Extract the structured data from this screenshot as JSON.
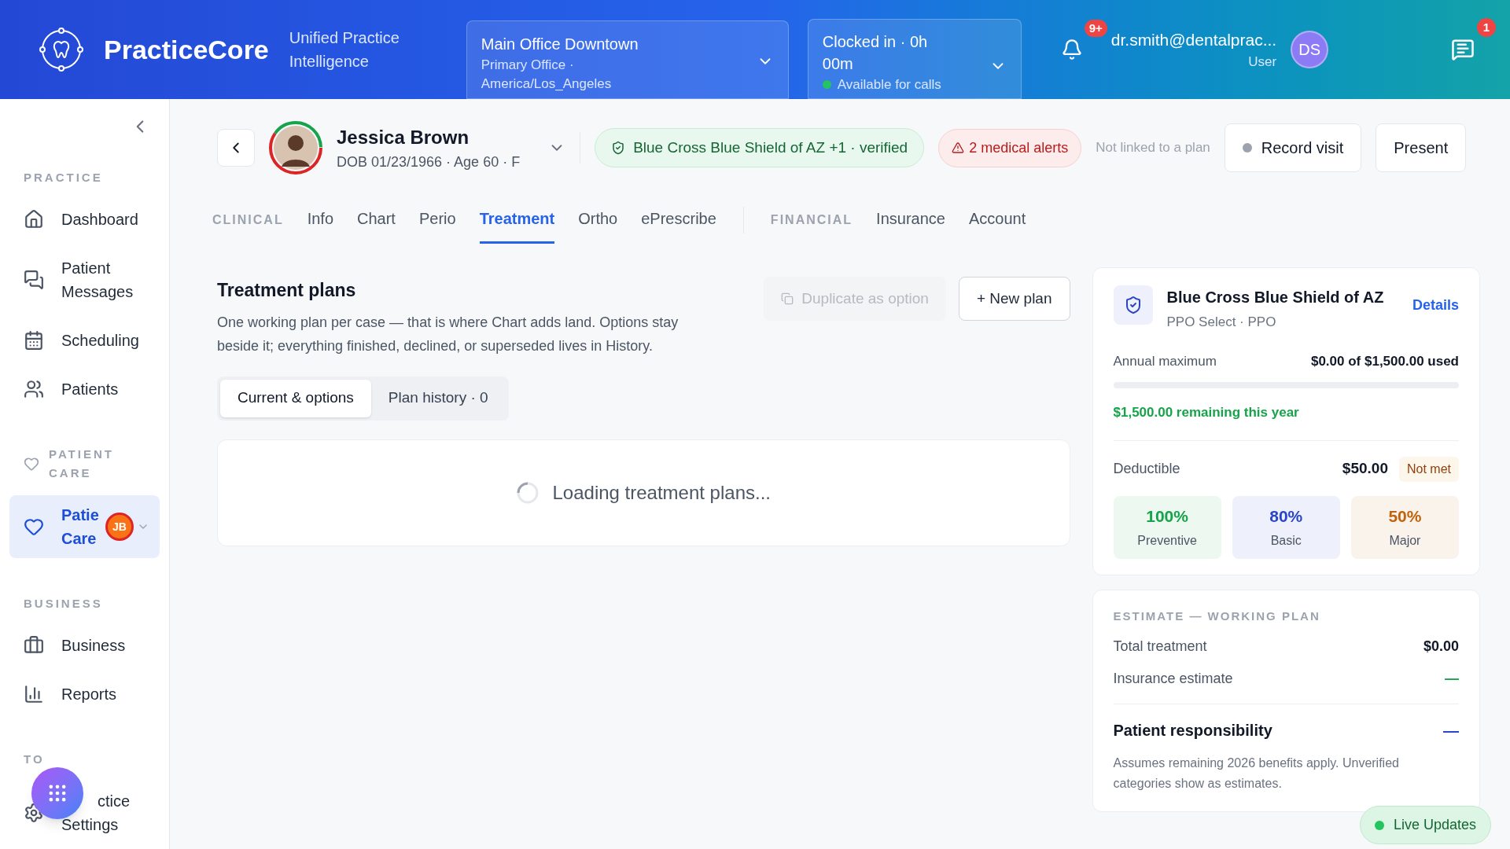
{
  "header": {
    "brand": "PracticeCore",
    "tagline": "Unified Practice Intelligence",
    "location": {
      "name": "Main Office Downtown",
      "detail": "Primary Office · America/Los_Angeles"
    },
    "clock": {
      "status": "Clocked in · 0h 00m",
      "availability": "Available for calls",
      "available": true
    },
    "notifications_badge": "9+",
    "user": {
      "email": "dr.smith@dentalprac...",
      "role": "User",
      "initials": "DS"
    },
    "messages_badge": "1"
  },
  "sidebar": {
    "sections": [
      {
        "title": "PRACTICE",
        "items": [
          {
            "label": "Dashboard",
            "selected": false
          },
          {
            "label": "Patient Messages",
            "selected": false
          },
          {
            "label": "Scheduling",
            "selected": false
          },
          {
            "label": "Patients",
            "selected": false
          }
        ]
      },
      {
        "title": "PATIENT CARE",
        "items": [
          {
            "label": "Patie Care",
            "selected": true,
            "badge": "JB"
          }
        ]
      },
      {
        "title": "BUSINESS",
        "items": [
          {
            "label": "Business",
            "selected": false
          },
          {
            "label": "Reports",
            "selected": false
          }
        ]
      },
      {
        "title": "TO",
        "items": [
          {
            "label": "ctice Settings",
            "selected": false
          }
        ]
      }
    ]
  },
  "patient": {
    "name": "Jessica Brown",
    "details": "DOB 01/23/1966 · Age 60 · F",
    "insurance": "Blue Cross Blue Shield of AZ +1 · verified",
    "alerts": "2 medical alerts",
    "plan_note": "Not linked to a plan",
    "buttons": [
      "Record visit",
      "Present"
    ]
  },
  "tab_groups": [
    {
      "label": "CLINICAL",
      "tabs": [
        {
          "label": "Info",
          "selected": false
        },
        {
          "label": "Chart",
          "selected": false
        },
        {
          "label": "Perio",
          "selected": false
        },
        {
          "label": "Treatment",
          "selected": true
        },
        {
          "label": "Ortho",
          "selected": false
        },
        {
          "label": "ePrescribe",
          "selected": false
        }
      ]
    },
    {
      "label": "FINANCIAL",
      "tabs": [
        {
          "label": "Insurance",
          "selected": false
        },
        {
          "label": "Account",
          "selected": false
        }
      ]
    }
  ],
  "treatment": {
    "title": "Treatment plans",
    "description": "One working plan per case — that is where Chart adds land. Options stay beside it; everything finished, declined, or superseded lives in History.",
    "actions": [
      {
        "label": "Duplicate as option",
        "disabled": true
      },
      {
        "label": "+ New plan",
        "disabled": false
      }
    ],
    "views": [
      {
        "label": "Current & options",
        "selected": true
      },
      {
        "label": "Plan history · 0",
        "selected": false
      }
    ],
    "loading": "Loading treatment plans..."
  },
  "insurance_card": {
    "carrier": "Blue Cross Blue Shield of AZ",
    "plan": "PPO Select · PPO",
    "link": "Details",
    "annual_label": "Annual maximum",
    "annual_value": "$0.00 of $1,500.00 used",
    "level": 0,
    "remaining": "$1,500.00 remaining this year",
    "deductible_label": "Deductible",
    "deductible_value": "$50.00",
    "deductible_status": "Not met",
    "coverage": [
      {
        "percent": "100%",
        "label": "Preventive",
        "color": "#16a34a"
      },
      {
        "percent": "80%",
        "label": "Basic",
        "color": "#2b45c8"
      },
      {
        "percent": "50%",
        "label": "Major",
        "color": "#c2620a"
      }
    ]
  },
  "estimate": {
    "title": "ESTIMATE — WORKING PLAN",
    "rows": [
      {
        "label": "Total treatment",
        "value": "$0.00"
      },
      {
        "label": "Insurance estimate",
        "value": "—"
      }
    ],
    "total_label": "Patient responsibility",
    "total_value": "—",
    "note": "Assumes remaining 2026 benefits apply. Unverified categories show as estimates."
  },
  "live_updates": "Live Updates"
}
